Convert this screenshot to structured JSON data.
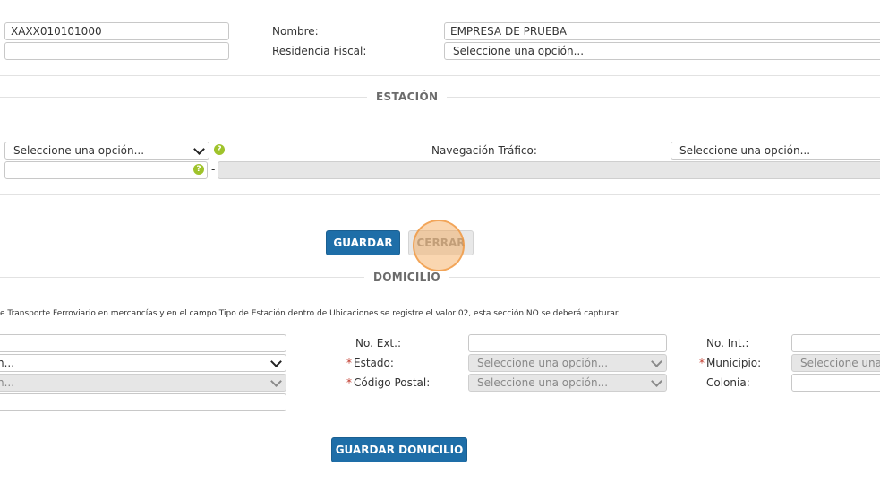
{
  "general": {
    "rfc_value": "XAXX010101000",
    "second_field_value": "",
    "nombre_label": "Nombre:",
    "nombre_value": "EMPRESA DE PRUEBA",
    "residencia_label": "Residencia Fiscal:",
    "residencia_value": "Seleccione una opción..."
  },
  "estacion": {
    "title": "ESTACIÓN",
    "select_value": "Seleccione una opción...",
    "help_symbol": "?",
    "navegacion_label": "Navegación Tráfico:",
    "navegacion_value": "Seleccione una opción...",
    "dash": "-"
  },
  "actions": {
    "guardar_label": "GUARDAR",
    "cerrar_label": "CERRAR"
  },
  "domicilio": {
    "title": "DOMICILIO",
    "note": "e Transporte Ferroviario en mercancías y en el campo Tipo de Estación dentro de Ubicaciones se registre el valor 02, esta sección NO se deberá capturar.",
    "no_ext_label": "No. Ext.:",
    "no_int_label": "No. Int.:",
    "estado_label": "Estado:",
    "municipio_label": "Municipio:",
    "codigo_postal_label": "Código Postal:",
    "colonia_label": "Colonia:",
    "left_select1_value": "n...",
    "left_select2_value": "n...",
    "estado_value": "Seleccione una opción...",
    "municipio_value": "Seleccione una o",
    "codigo_postal_value": "Seleccione una opción...",
    "required_mark": "*",
    "guardar_domicilio_label": "GUARDAR DOMICILIO"
  },
  "colors": {
    "primary_button": "#1e6ea8",
    "help_icon": "#9fc32b",
    "click_highlight": "#f5a550"
  }
}
